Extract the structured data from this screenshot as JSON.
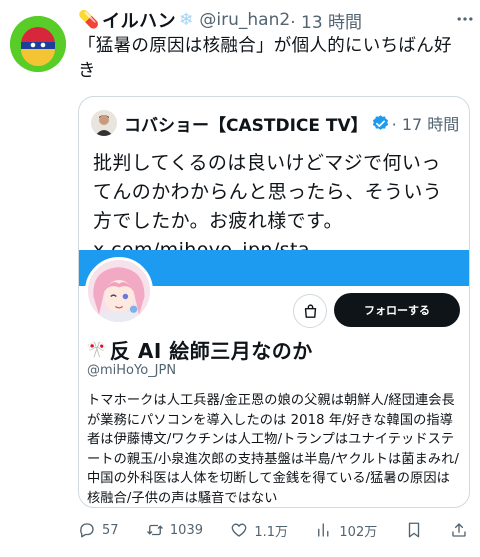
{
  "tweet": {
    "author": {
      "emoji_prefix": "💊",
      "display_name": "イルハン",
      "emoji_suffix": "❄",
      "handle": "@iru_han2",
      "time": "· 13 時間"
    },
    "text": "「猛暑の原因は核融合」が個人的にいちばん好き",
    "more_icon": "more-dots-icon"
  },
  "quote": {
    "author": {
      "display_name": "コバショー【CASTDICE TV】",
      "verified": true,
      "time": "· 17 時間"
    },
    "text": "批判してくるのは良いけどマジで何いってんのかわからんと思ったら、そういう方でしたか。お疲れ様です。 x.com/mihoyo_jpn/sta…",
    "card": {
      "banner_color": "#1d9bf0",
      "follow_label": "フォローする",
      "profile_emoji": "🎌",
      "profile_name": "反 AI 絵師三月なのか",
      "profile_handle": "@miHoYo_JPN",
      "bio": "トマホークは人工兵器/金正恩の娘の父親は朝鮮人/経団連会長が業務にパソコンを導入したのは 2018 年/好きな韓国の指導者は伊藤博文/ワクチンは人工物/トランプはユナイテッドステートの親玉/小泉進次郎の支持基盤は半島/ヤクルトは菌まみれ/中国の外科医は人体を切断して金銭を得ている/猛暑の原因は核融合/子供の声は騒音ではない"
    }
  },
  "actions": {
    "replies": "57",
    "retweets": "1039",
    "likes": "1.1万",
    "views": "102万"
  },
  "colors": {
    "accent": "#1d9bf0",
    "muted": "#536471",
    "text": "#0f1419",
    "border": "#cfd9de"
  }
}
